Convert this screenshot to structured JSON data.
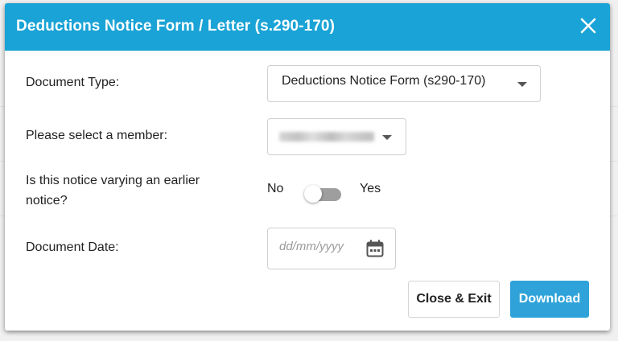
{
  "modal": {
    "title": "Deductions Notice Form / Letter (s.290-170)"
  },
  "form": {
    "document_type": {
      "label": "Document Type:",
      "selected": "Deductions Notice Form (s290-170)"
    },
    "member": {
      "label": "Please select a member:",
      "selected": ""
    },
    "varying": {
      "label_line1": "Is this notice varying an earlier",
      "label_line2": "notice?",
      "off_label": "No",
      "on_label": "Yes",
      "value": false
    },
    "document_date": {
      "label": "Document Date:",
      "placeholder": "dd/mm/yyyy",
      "value": ""
    }
  },
  "buttons": {
    "close_label": "Close & Exit",
    "download_label": "Download"
  },
  "colors": {
    "header": "#1aa3d6",
    "primary_button": "#2fa3d9",
    "toggle_track": "#9e9e9e"
  },
  "icons": {
    "close": "close-icon",
    "dropdown": "chevron-down-icon",
    "calendar": "calendar-icon"
  }
}
